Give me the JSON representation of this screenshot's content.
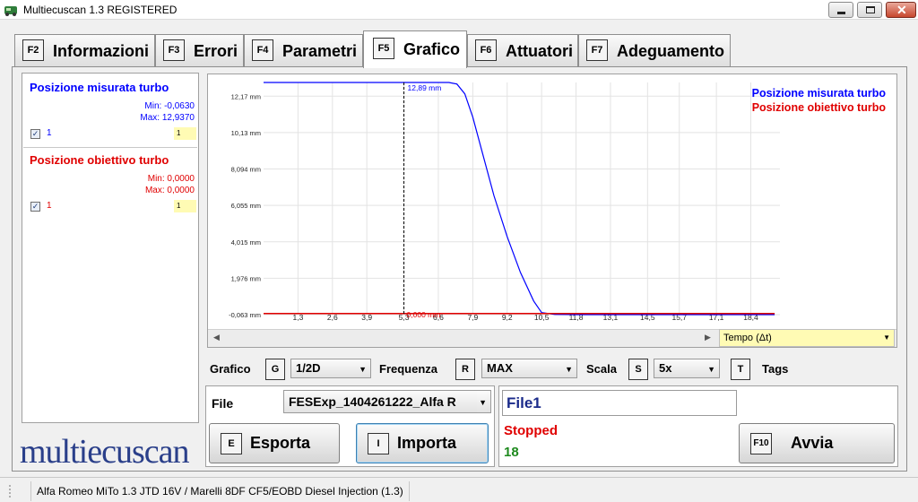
{
  "window": {
    "title": "Multiecuscan 1.3 REGISTERED"
  },
  "tabs": [
    {
      "key": "F2",
      "label": "Informazioni",
      "active": false
    },
    {
      "key": "F3",
      "label": "Errori",
      "active": false
    },
    {
      "key": "F4",
      "label": "Parametri",
      "active": false
    },
    {
      "key": "F5",
      "label": "Grafico",
      "active": true
    },
    {
      "key": "F6",
      "label": "Attuatori",
      "active": false
    },
    {
      "key": "F7",
      "label": "Adeguamento",
      "active": false
    }
  ],
  "series_panel": [
    {
      "name": "Posizione misurata turbo",
      "color": "#0000ff",
      "min": "Min: -0,0630",
      "max": "Max: 12,9370",
      "checked": true,
      "index": "1",
      "scale": "1"
    },
    {
      "name": "Posizione obiettivo turbo",
      "color": "#e00000",
      "min": "Min: 0,0000",
      "max": "Max: 0,0000",
      "checked": true,
      "index": "1",
      "scale": "1"
    }
  ],
  "logo": "multiecuscan",
  "chart_data": {
    "type": "line",
    "yticks": [
      "12,17 mm",
      "10,13 mm",
      "8,094 mm",
      "6,055 mm",
      "4,015 mm",
      "1,976 mm",
      "-0,063 mm"
    ],
    "xticks": [
      "1,3",
      "2,6",
      "3,9",
      "5,3",
      "6,6",
      "7,9",
      "9,2",
      "10,5",
      "11,8",
      "13,1",
      "14,5",
      "15,7",
      "17,1",
      "18,4"
    ],
    "xlim": [
      0,
      19.5
    ],
    "ylim": [
      -0.063,
      12.937
    ],
    "grid": true,
    "legend_position": "top-right",
    "cursor": {
      "x": 5.3,
      "blue_label": "12,89 mm",
      "red_label": "0,000 mm"
    },
    "series": [
      {
        "name": "Posizione misurata turbo",
        "color": "#0000ff",
        "x": [
          0,
          7.0,
          7.3,
          7.6,
          7.9,
          8.3,
          8.7,
          9.2,
          9.7,
          10.2,
          10.5,
          11.0,
          11.8,
          13.1,
          14.5,
          15.7,
          17.1,
          18.4,
          19.3
        ],
        "y": [
          12.937,
          12.937,
          12.85,
          12.3,
          11.0,
          8.8,
          6.6,
          4.3,
          2.3,
          0.7,
          0.05,
          -0.05,
          -0.063,
          -0.063,
          -0.063,
          -0.063,
          -0.063,
          -0.063,
          -0.063
        ]
      },
      {
        "name": "Posizione obiettivo turbo",
        "color": "#e00000",
        "x": [
          0,
          19.3
        ],
        "y": [
          0,
          0
        ]
      }
    ],
    "xaxis_selector": "Tempo (Δt)"
  },
  "controls": {
    "grafico_label": "Grafico",
    "grafico_key": "G",
    "grafico_value": "1/2D",
    "frequenza_label": "Frequenza",
    "frequenza_key": "R",
    "frequenza_value": "MAX",
    "scala_label": "Scala",
    "scala_key": "S",
    "scala_value": "5x",
    "tags_key": "T",
    "tags_label": "Tags"
  },
  "file": {
    "label": "File",
    "selected": "FESExp_1404261222_Alfa R",
    "export_key": "E",
    "export_label": "Esporta",
    "import_key": "I",
    "import_label": "Importa"
  },
  "recording": {
    "file_name": "File1",
    "status": "Stopped",
    "count": "18",
    "start_key": "F10",
    "start_label": "Avvia"
  },
  "statusbar": {
    "vehicle": "Alfa Romeo MiTo 1.3 JTD 16V / Marelli 8DF CF5/EOBD Diesel Injection (1.3)"
  }
}
